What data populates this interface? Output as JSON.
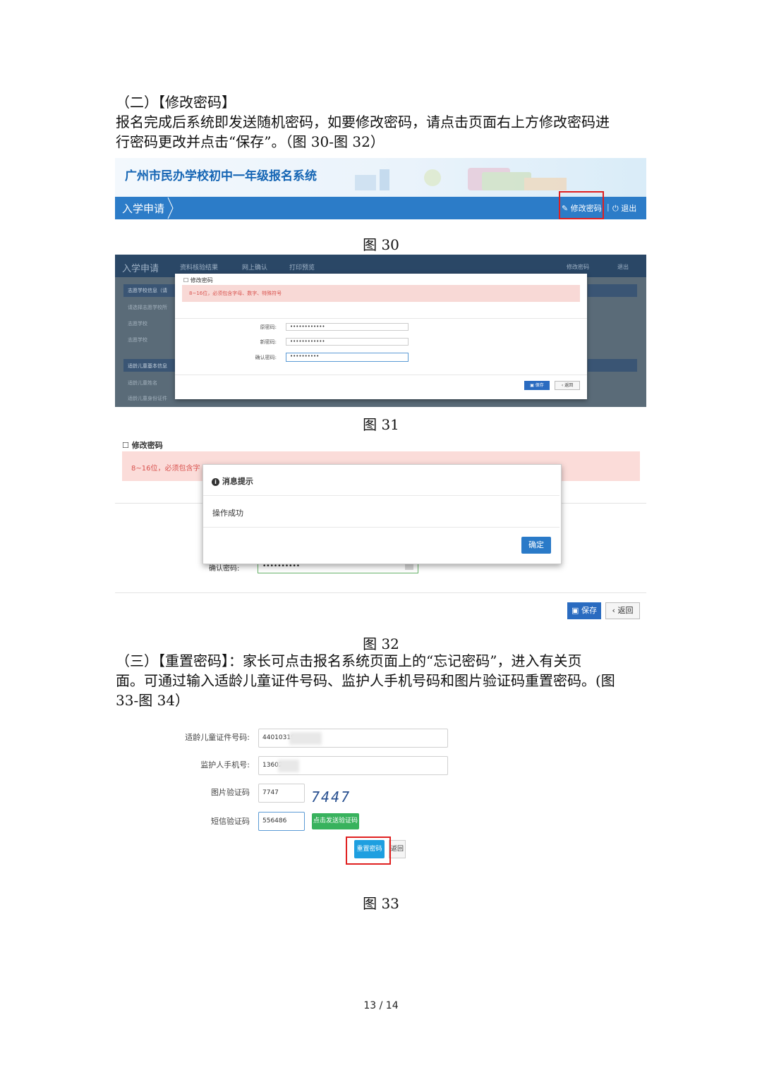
{
  "section2": {
    "heading": "（二）【修改密码】",
    "line1": "报名完成后系统即发送随机密码，如要修改密码，请点击页面右上方修改密码进",
    "line2": "行密码更改并点击“保存”。（图 30-图 32）"
  },
  "fig30": {
    "system_title": "广州市民办学校初中一年级报名系统",
    "nav_tab": "入学申请",
    "change_password": "修改密码",
    "logout": "退出",
    "caption": "图 30"
  },
  "fig31": {
    "tabs": [
      "入学申请",
      "资料核验结果",
      "网上确认",
      "打印预览"
    ],
    "change_password": "修改密码",
    "logout": "退出",
    "side_items": [
      "志愿学校信息（请",
      "请选择志愿学校所",
      "志愿学校",
      "志愿学校",
      "适龄儿童基本信息",
      "适龄儿童姓名",
      "适龄儿童身份证件"
    ],
    "modal_title": "修改密码",
    "hint": "8~16位，必须包含字母、数字、特殊符号",
    "labels": {
      "old": "原密码:",
      "new": "新密码:",
      "confirm": "确认密码:"
    },
    "values": {
      "old": "••••••••••••",
      "new": "••••••••••••",
      "confirm": "••••••••••"
    },
    "save": "保存",
    "back": "返回",
    "caption": "图 31"
  },
  "fig32": {
    "title": "修改密码",
    "hint": "8~16位，必须包含字",
    "dialog_title": "消息提示",
    "dialog_body": "操作成功",
    "ok": "确定",
    "confirm_label": "确认密码:",
    "confirm_value": "••••••••••",
    "save": "保存",
    "back": "返回",
    "caption": "图 32"
  },
  "section3": {
    "line1": "（三）【重置密码】：家长可点击报名系统页面上的“忘记密码”，进入有关页",
    "line2": "面。可通过输入适龄儿童证件号码、监护人手机号码和图片验证码重置密码。(图",
    "line3": "33-图 34）"
  },
  "fig33": {
    "labels": {
      "id": "适龄儿童证件号码:",
      "phone": "监护人手机号:",
      "captcha": "图片验证码",
      "sms": "短信验证码"
    },
    "values": {
      "id": "44010319",
      "phone": "13602",
      "captcha": "7747",
      "sms": "556486"
    },
    "captcha_image_text": "7447",
    "send_sms": "点击发送验证码",
    "reset": "重置密码",
    "back": "返回",
    "caption": "图 33"
  },
  "page_number": "13 / 14",
  "colors": {
    "nav_blue": "#2c7cc8",
    "highlight_red": "#e02020",
    "alert_pink": "#fbdcd9",
    "sms_green": "#38b25d"
  }
}
